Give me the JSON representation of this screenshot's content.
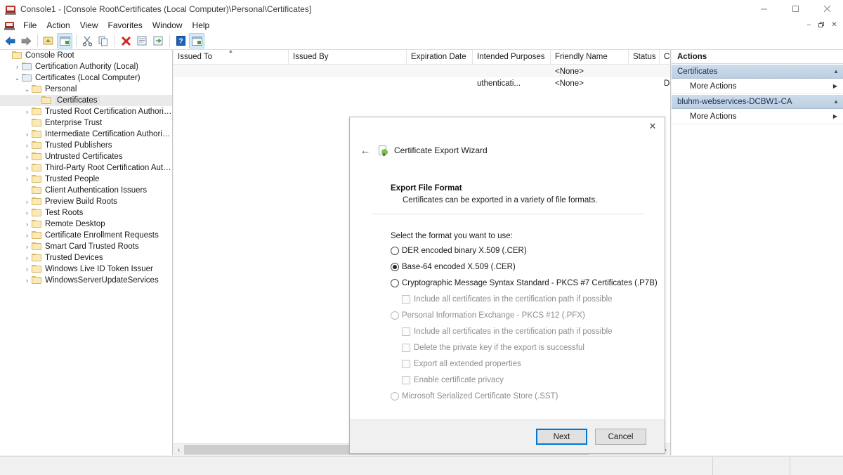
{
  "window": {
    "title": "Console1 - [Console Root\\Certificates (Local Computer)\\Personal\\Certificates]",
    "icon": "console-icon",
    "controls": {
      "minimize": "─",
      "maximize": "□",
      "close": "✕"
    },
    "mdi_controls": {
      "minimize": "–",
      "restore": "❐",
      "close": "✕"
    }
  },
  "menu": {
    "items": [
      {
        "label": "File"
      },
      {
        "label": "Action"
      },
      {
        "label": "View"
      },
      {
        "label": "Favorites"
      },
      {
        "label": "Window"
      },
      {
        "label": "Help"
      }
    ]
  },
  "toolbar": {
    "buttons": [
      {
        "name": "back-button",
        "icon": "arrow-left-icon"
      },
      {
        "name": "forward-button",
        "icon": "arrow-right-icon"
      },
      {
        "name": "up-folder-button",
        "icon": "folder-up-icon"
      },
      {
        "name": "show-hide-tree-button",
        "icon": "console-tree-icon"
      },
      {
        "name": "cut-button",
        "icon": "scissors-icon"
      },
      {
        "name": "copy-button",
        "icon": "copy-icon"
      },
      {
        "name": "delete-button",
        "icon": "delete-x-icon"
      },
      {
        "name": "properties-button",
        "icon": "properties-icon"
      },
      {
        "name": "export-button",
        "icon": "export-icon"
      },
      {
        "name": "help-button",
        "icon": "help-question-icon"
      },
      {
        "name": "view-button",
        "icon": "view-window-icon"
      }
    ]
  },
  "tree": {
    "items": [
      {
        "label": "Console Root",
        "indent": 0,
        "chevron": "",
        "kind": "folder"
      },
      {
        "label": "Certification Authority (Local)",
        "indent": 1,
        "chevron": "›",
        "kind": "ca"
      },
      {
        "label": "Certificates (Local Computer)",
        "indent": 1,
        "chevron": "⌄",
        "kind": "cert-store"
      },
      {
        "label": "Personal",
        "indent": 2,
        "chevron": "⌄",
        "kind": "folder"
      },
      {
        "label": "Certificates",
        "indent": 3,
        "chevron": "",
        "kind": "folder",
        "selected": true
      },
      {
        "label": "Trusted Root Certification Authorities",
        "indent": 2,
        "chevron": "›",
        "kind": "folder"
      },
      {
        "label": "Enterprise Trust",
        "indent": 2,
        "chevron": "",
        "kind": "folder"
      },
      {
        "label": "Intermediate Certification Authorities",
        "indent": 2,
        "chevron": "›",
        "kind": "folder"
      },
      {
        "label": "Trusted Publishers",
        "indent": 2,
        "chevron": "›",
        "kind": "folder"
      },
      {
        "label": "Untrusted Certificates",
        "indent": 2,
        "chevron": "›",
        "kind": "folder"
      },
      {
        "label": "Third-Party Root Certification Authorities",
        "indent": 2,
        "chevron": "›",
        "kind": "folder"
      },
      {
        "label": "Trusted People",
        "indent": 2,
        "chevron": "›",
        "kind": "folder"
      },
      {
        "label": "Client Authentication Issuers",
        "indent": 2,
        "chevron": "",
        "kind": "folder"
      },
      {
        "label": "Preview Build Roots",
        "indent": 2,
        "chevron": "›",
        "kind": "folder"
      },
      {
        "label": "Test Roots",
        "indent": 2,
        "chevron": "›",
        "kind": "folder"
      },
      {
        "label": "Remote Desktop",
        "indent": 2,
        "chevron": "›",
        "kind": "folder"
      },
      {
        "label": "Certificate Enrollment Requests",
        "indent": 2,
        "chevron": "›",
        "kind": "folder"
      },
      {
        "label": "Smart Card Trusted Roots",
        "indent": 2,
        "chevron": "›",
        "kind": "folder"
      },
      {
        "label": "Trusted Devices",
        "indent": 2,
        "chevron": "›",
        "kind": "folder"
      },
      {
        "label": "Windows Live ID Token Issuer",
        "indent": 2,
        "chevron": "›",
        "kind": "folder"
      },
      {
        "label": "WindowsServerUpdateServices",
        "indent": 2,
        "chevron": "›",
        "kind": "folder"
      }
    ]
  },
  "listview": {
    "columns": [
      {
        "label": "Issued To",
        "width": 164,
        "sorted": true,
        "sort_arrow": "▲"
      },
      {
        "label": "Issued By",
        "width": 168
      },
      {
        "label": "Expiration Date",
        "width": 94
      },
      {
        "label": "Intended Purposes",
        "width": 111
      },
      {
        "label": "Friendly Name",
        "width": 111
      },
      {
        "label": "Status",
        "width": 44
      },
      {
        "label": "Certifi",
        "width": 16
      }
    ],
    "rows": [
      {
        "issued_to": "",
        "issued_by": "",
        "expiration": "",
        "purposes": "",
        "friendly_name": "<None>",
        "status": "",
        "template": ""
      },
      {
        "issued_to": "",
        "issued_by": "",
        "expiration": "",
        "purposes": "uthenticati...",
        "friendly_name": "<None>",
        "status": "",
        "template": "Doma"
      }
    ],
    "hscroll": {
      "left_arrow": "‹",
      "right_arrow": "›",
      "thumb_percent": 85
    }
  },
  "wizard": {
    "app_title": "Certificate Export Wizard",
    "back_glyph": "←",
    "close_glyph": "✕",
    "heading": "Export File Format",
    "subheading": "Certificates can be exported in a variety of file formats.",
    "prompt": "Select the format you want to use:",
    "options": [
      {
        "label": "DER encoded binary X.509 (.CER)",
        "type": "radio",
        "selected": false,
        "disabled": false,
        "sub": false
      },
      {
        "label": "Base-64 encoded X.509 (.CER)",
        "type": "radio",
        "selected": true,
        "disabled": false,
        "sub": false
      },
      {
        "label": "Cryptographic Message Syntax Standard - PKCS #7 Certificates (.P7B)",
        "type": "radio",
        "selected": false,
        "disabled": false,
        "sub": false
      },
      {
        "label": "Include all certificates in the certification path if possible",
        "type": "checkbox",
        "checked": false,
        "disabled": true,
        "sub": true
      },
      {
        "label": "Personal Information Exchange - PKCS #12 (.PFX)",
        "type": "radio",
        "selected": false,
        "disabled": true,
        "sub": false
      },
      {
        "label": "Include all certificates in the certification path if possible",
        "type": "checkbox",
        "checked": false,
        "disabled": true,
        "sub": true
      },
      {
        "label": "Delete the private key if the export is successful",
        "type": "checkbox",
        "checked": false,
        "disabled": true,
        "sub": true
      },
      {
        "label": "Export all extended properties",
        "type": "checkbox",
        "checked": false,
        "disabled": true,
        "sub": true
      },
      {
        "label": "Enable certificate privacy",
        "type": "checkbox",
        "checked": false,
        "disabled": true,
        "sub": true
      },
      {
        "label": "Microsoft Serialized Certificate Store (.SST)",
        "type": "radio",
        "selected": false,
        "disabled": true,
        "sub": false
      }
    ],
    "buttons": {
      "next": "Next",
      "cancel": "Cancel"
    }
  },
  "actions": {
    "title": "Actions",
    "groups": [
      {
        "name": "Certificates",
        "caret": "▲",
        "items": [
          {
            "label": "More Actions",
            "arrow": "▶"
          }
        ]
      },
      {
        "name": "bluhm-webservices-DCBW1-CA",
        "caret": "▲",
        "items": [
          {
            "label": "More Actions",
            "arrow": "▶"
          }
        ]
      }
    ]
  },
  "statusbar": {
    "text": ""
  },
  "colors": {
    "accent": "#0078d7",
    "actions_group": "#bccfe2",
    "selection": "#eaeaea",
    "folder": "#fbe9b7"
  }
}
